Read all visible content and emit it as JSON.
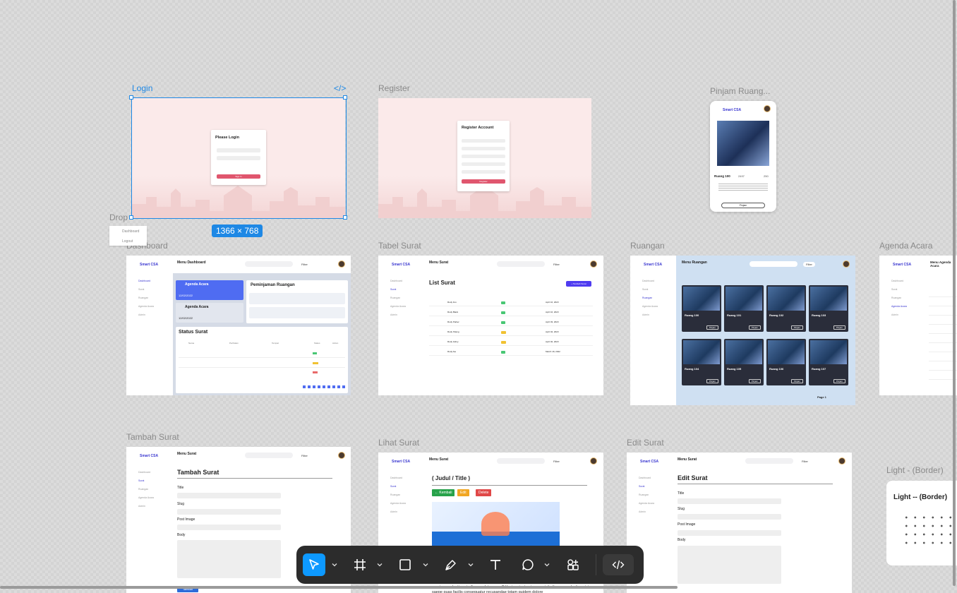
{
  "canvas": {
    "frame_labels": {
      "login": "Login",
      "register": "Register",
      "pinjam_ruang": "Pinjam Ruang...",
      "drop": "Drop",
      "dashboard": "Dashboard",
      "tabel_surat": "Tabel Surat",
      "ruangan": "Ruangan",
      "agenda_acara": "Agenda Acara",
      "tambah_surat": "Tambah Surat",
      "lihat_surat": "Lihat Surat",
      "edit_surat": "Edit Surat",
      "light_border": "Light - (Border)"
    },
    "selection_size": "1366 × 768",
    "code_icon_label": "</>"
  },
  "dropdown": {
    "items": [
      "Dashboard",
      "Logout"
    ]
  },
  "login": {
    "heading": "Please Login",
    "button": "Sign In"
  },
  "register": {
    "heading": "Register Account",
    "button": "Register"
  },
  "pinjam": {
    "brand": "Smart CSA",
    "room_name": "Ruang 100",
    "likes": "2497",
    "comments": "250",
    "button": "Pinjam"
  },
  "app": {
    "brand": "Smart CSA",
    "sidebar": [
      "Dashboard",
      "Surat",
      "Ruangan",
      "Agenda Acara",
      "Admin"
    ],
    "filter": "Filter",
    "search_placeholder": "Search"
  },
  "dashboard": {
    "title": "Menu Dashboard",
    "agenda_title": "Agenda Acara",
    "agenda_date_1": "12/02/2022",
    "agenda_date_2": "12/02/2022",
    "peminjaman_title": "Peminjaman Ruangan",
    "status_title": "Status Surat",
    "columns": [
      "Nama",
      "Perihalan",
      "Tempat",
      "Status",
      "Action"
    ]
  },
  "tabel": {
    "title": "Menu Surat",
    "list_title": "List Surat",
    "add_button": "+ Tambah Surat",
    "rows": [
      "Rudy Fox",
      "Rudy Black",
      "Rudy Parker",
      "Rudy Shang",
      "Rudy Gilroy",
      "Rudy Ate"
    ],
    "dates": [
      "April 16, 2023",
      "April 16, 2023",
      "April 03, 2023",
      "April 04, 2023",
      "April 02, 2023",
      "March 18, 2022"
    ]
  },
  "ruangan": {
    "title": "Menu Ruangan",
    "rooms": [
      "Ruang 100",
      "Ruang 101",
      "Ruang 102",
      "Ruang 103",
      "Ruang 104",
      "Ruang 105",
      "Ruang 106",
      "Ruang 107"
    ],
    "pinjam": "Pinjam",
    "page": "Page 1"
  },
  "agenda": {
    "title": "Menu Agenda Acara"
  },
  "tambah": {
    "title": "Menu Surat",
    "heading": "Tambah Surat",
    "fields": [
      "Title",
      "Slug",
      "Post Image",
      "Body"
    ],
    "button": "Tambah"
  },
  "lihat": {
    "title": "Menu Surat",
    "heading": "( Judul / Title )",
    "kembali": "← Kembali",
    "edit": "Edit",
    "delete": "Delete",
    "body_text": "aperiam molestias similique soluta quam? Veniam iusto eius suscipit aliquam molestiae nisi saepe quas facilis consequatur recusandae totam quidem dolore"
  },
  "edit": {
    "title": "Menu Surat",
    "heading": "Edit Surat",
    "fields": [
      "Title",
      "Slug",
      "Post Image",
      "Body"
    ]
  },
  "light": {
    "title": "Light -- (Border)"
  },
  "toolbar": {
    "tools": [
      "move-tool",
      "frame-tool",
      "shape-tool",
      "pen-tool",
      "text-tool",
      "comment-tool",
      "actions-tool",
      "dev-mode-toggle"
    ]
  }
}
